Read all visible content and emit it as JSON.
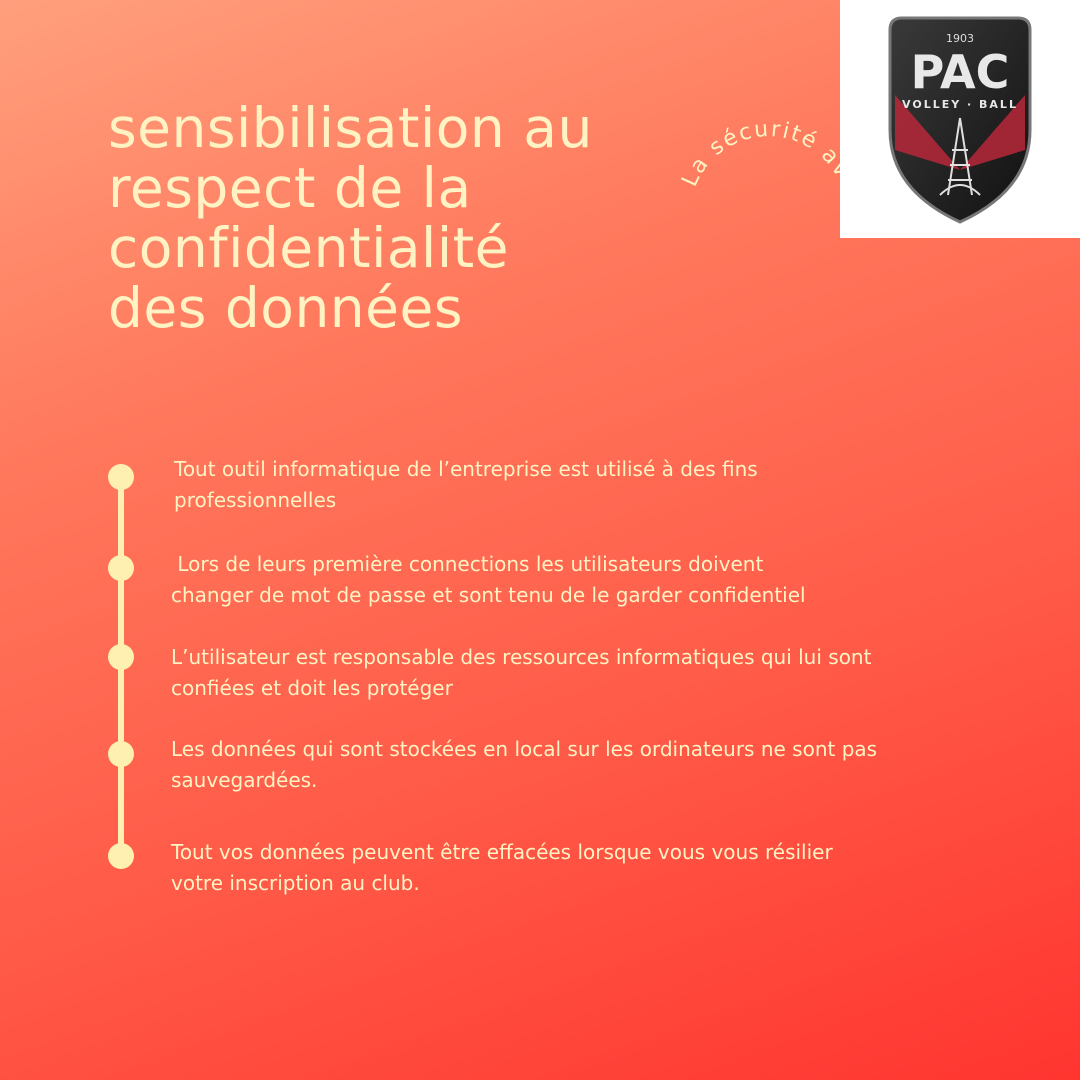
{
  "title_lines": [
    "sensibilisation au",
    "respect de la",
    "confidentialité",
    "des données"
  ],
  "arc_tagline": "La sécurité avant tout",
  "logo": {
    "year": "1903",
    "name": "PAC",
    "sub": "VOLLEY · BALL"
  },
  "items": [
    {
      "line1": "Tout outil informatique de l’entreprise est utilisé à des fins",
      "line2": "professionnelles"
    },
    {
      "line1": " Lors de leurs première connections les utilisateurs doivent",
      "line2": "changer de mot de passe et sont tenu de le garder confidentiel"
    },
    {
      "line1": "L’utilisateur est responsable des ressources informatiques qui lui sont",
      "line2": "confiées et doit les protéger"
    },
    {
      "line1": "Les données qui sont stockées en local sur les ordinateurs ne sont pas",
      "line2": "sauvegardées."
    },
    {
      "line1": "Tout vos données peuvent être effacées lorsque vous vous résilier",
      "line2": "votre inscription au club."
    }
  ],
  "colors": {
    "text": "#fff3c4",
    "accent": "#fdf0b0",
    "bg_top": "#ff9f7c",
    "bg_bottom": "#ff3530"
  }
}
